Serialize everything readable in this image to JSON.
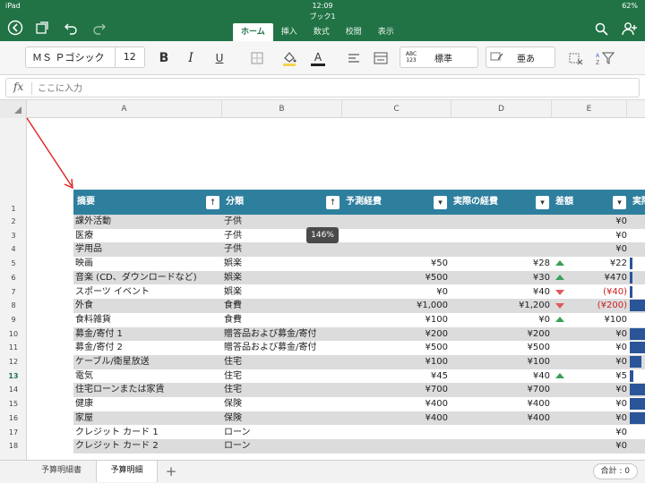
{
  "status": {
    "device": "iPad",
    "time": "12:09",
    "battery": "62%"
  },
  "document": {
    "title": "ブック1"
  },
  "ribbon": {
    "tabs": [
      {
        "label": "ホーム",
        "active": true
      },
      {
        "label": "挿入",
        "active": false
      },
      {
        "label": "数式",
        "active": false
      },
      {
        "label": "校閲",
        "active": false
      },
      {
        "label": "表示",
        "active": false
      }
    ]
  },
  "toolbar": {
    "font_name": "ＭＳ Ｐゴシック",
    "font_size": "12",
    "bold": "B",
    "italic": "I",
    "underline": "U",
    "font_color_glyph": "A",
    "number_format_icon": "ABC 123",
    "number_format": "標準",
    "cell_style": "亜あ"
  },
  "formula_bar": {
    "fx": "fx",
    "placeholder": "ここに入力"
  },
  "column_headers": [
    "A",
    "B",
    "C",
    "D",
    "E"
  ],
  "row_numbers": [
    "1",
    "2",
    "3",
    "4",
    "5",
    "6",
    "7",
    "8",
    "9",
    "10",
    "11",
    "12",
    "13",
    "14",
    "15",
    "16",
    "17",
    "18"
  ],
  "selected_row": "13",
  "table": {
    "headers": [
      "摘要",
      "分類",
      "予測経費",
      "実際の経費",
      "差額",
      "実際"
    ],
    "filter_sort_up": "↑",
    "filter_dropdown": "▾",
    "rows": [
      {
        "desc": "課外活動",
        "category": "子供",
        "forecast": "",
        "actual": "",
        "trend": "",
        "diff": "¥0",
        "diff_negative": false,
        "bar": 0
      },
      {
        "desc": "医療",
        "category": "子供",
        "forecast": "",
        "actual": "",
        "trend": "",
        "diff": "¥0",
        "diff_negative": false,
        "bar": 0
      },
      {
        "desc": "学用品",
        "category": "子供",
        "forecast": "",
        "actual": "",
        "trend": "",
        "diff": "¥0",
        "diff_negative": false,
        "bar": 0
      },
      {
        "desc": "映画",
        "category": "娯楽",
        "forecast": "¥50",
        "actual": "¥28",
        "trend": "up",
        "diff": "¥22",
        "diff_negative": false,
        "bar": 0.15
      },
      {
        "desc": "音楽 (CD、ダウンロードなど)",
        "category": "娯楽",
        "forecast": "¥500",
        "actual": "¥30",
        "trend": "up",
        "diff": "¥470",
        "diff_negative": false,
        "bar": 0.15
      },
      {
        "desc": "スポーツ イベント",
        "category": "娯楽",
        "forecast": "¥0",
        "actual": "¥40",
        "trend": "down",
        "diff": "(¥40)",
        "diff_negative": true,
        "bar": 0.15
      },
      {
        "desc": "外食",
        "category": "食費",
        "forecast": "¥1,000",
        "actual": "¥1,200",
        "trend": "down",
        "diff": "(¥200)",
        "diff_negative": true,
        "bar": 1.0
      },
      {
        "desc": "食料雑貨",
        "category": "食費",
        "forecast": "¥100",
        "actual": "¥0",
        "trend": "up",
        "diff": "¥100",
        "diff_negative": false,
        "bar": 0
      },
      {
        "desc": "募金/寄付 1",
        "category": "贈答品および募金/寄付",
        "forecast": "¥200",
        "actual": "¥200",
        "trend": "",
        "diff": "¥0",
        "diff_negative": false,
        "bar": 1.0
      },
      {
        "desc": "募金/寄付 2",
        "category": "贈答品および募金/寄付",
        "forecast": "¥500",
        "actual": "¥500",
        "trend": "",
        "diff": "¥0",
        "diff_negative": false,
        "bar": 1.0
      },
      {
        "desc": "ケーブル/衛星放送",
        "category": "住宅",
        "forecast": "¥100",
        "actual": "¥100",
        "trend": "",
        "diff": "¥0",
        "diff_negative": false,
        "bar": 0.6
      },
      {
        "desc": "電気",
        "category": "住宅",
        "forecast": "¥45",
        "actual": "¥40",
        "trend": "up",
        "diff": "¥5",
        "diff_negative": false,
        "bar": 0.2
      },
      {
        "desc": "住宅ローンまたは家賃",
        "category": "住宅",
        "forecast": "¥700",
        "actual": "¥700",
        "trend": "",
        "diff": "¥0",
        "diff_negative": false,
        "bar": 1.0
      },
      {
        "desc": "健康",
        "category": "保険",
        "forecast": "¥400",
        "actual": "¥400",
        "trend": "",
        "diff": "¥0",
        "diff_negative": false,
        "bar": 1.0
      },
      {
        "desc": "家屋",
        "category": "保険",
        "forecast": "¥400",
        "actual": "¥400",
        "trend": "",
        "diff": "¥0",
        "diff_negative": false,
        "bar": 1.0
      },
      {
        "desc": "クレジット カード 1",
        "category": "ローン",
        "forecast": "",
        "actual": "",
        "trend": "",
        "diff": "¥0",
        "diff_negative": false,
        "bar": 0
      },
      {
        "desc": "クレジット カード 2",
        "category": "ローン",
        "forecast": "",
        "actual": "",
        "trend": "",
        "diff": "¥0",
        "diff_negative": false,
        "bar": 0
      }
    ]
  },
  "zoom_badge": "146%",
  "sheet_tabs": [
    {
      "label": "予算明細書",
      "active": false
    },
    {
      "label": "予算明細",
      "active": true
    }
  ],
  "add_sheet": "+",
  "status_sum": "合計 : 0",
  "colors": {
    "ribbon": "#217346",
    "table_header": "#2e7f9e",
    "band": "#dcdcdc",
    "databar": "#2a5598",
    "up": "#3aa05a",
    "down": "#e05a5a",
    "negative": "#cc1f1f"
  }
}
